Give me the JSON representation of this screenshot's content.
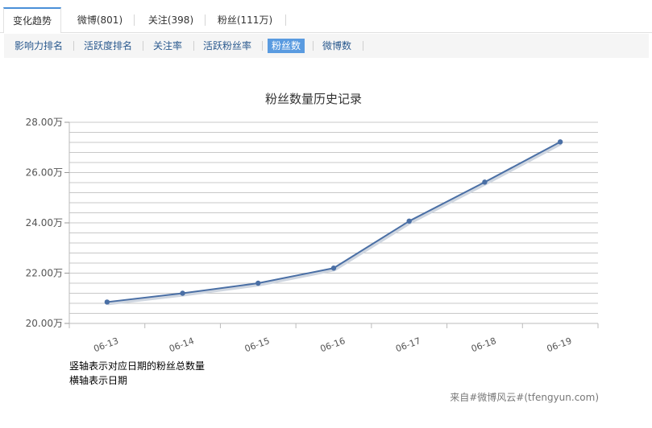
{
  "tabs": [
    {
      "label": "变化趋势",
      "active": true
    },
    {
      "label": "微博(801)",
      "active": false
    },
    {
      "label": "关注(398)",
      "active": false
    },
    {
      "label": "粉丝(111万)",
      "active": false
    }
  ],
  "subtabs": [
    {
      "label": "影响力排名",
      "active": false
    },
    {
      "label": "活跃度排名",
      "active": false
    },
    {
      "label": "关注率",
      "active": false
    },
    {
      "label": "活跃粉丝率",
      "active": false
    },
    {
      "label": "粉丝数",
      "active": true
    },
    {
      "label": "微博数",
      "active": false
    }
  ],
  "chart_data": {
    "type": "line",
    "title": "粉丝数量历史记录",
    "categories": [
      "06-13",
      "06-14",
      "06-15",
      "06-16",
      "06-17",
      "06-18",
      "06-19"
    ],
    "series": [
      {
        "values": [
          20.85,
          21.2,
          21.6,
          22.2,
          24.07,
          25.62,
          27.22
        ]
      }
    ],
    "ylim": [
      20,
      28
    ],
    "yticks": [
      20,
      22,
      24,
      26,
      28
    ],
    "ytick_labels": [
      "20.00万",
      "22.00万",
      "24.00万",
      "26.00万",
      "28.00万"
    ],
    "grid": true,
    "line_color": "#4a6fa5",
    "grid_color": "#c8c8c8"
  },
  "notes": {
    "line1": "竖轴表示对应日期的粉丝总数量",
    "line2": "横轴表示日期"
  },
  "credit": "来自#微博风云#(tfengyun.com)"
}
